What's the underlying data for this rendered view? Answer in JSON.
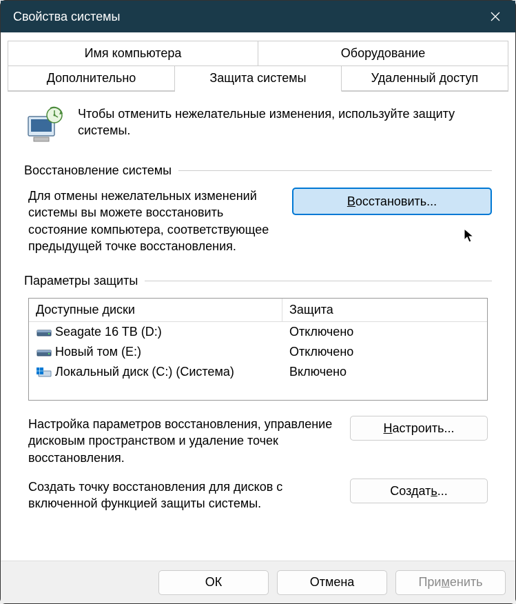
{
  "title": "Свойства системы",
  "tabs": {
    "row1": [
      "Имя компьютера",
      "Оборудование"
    ],
    "row2": [
      "Дополнительно",
      "Защита системы",
      "Удаленный доступ"
    ],
    "active": "Защита системы"
  },
  "intro": "Чтобы отменить нежелательные изменения, используйте защиту системы.",
  "restore": {
    "section_title": "Восстановление системы",
    "desc": "Для отмены нежелательных изменений системы вы можете восстановить состояние компьютера, соответствующее предыдущей точке восстановления.",
    "button": "Восстановить..."
  },
  "protection": {
    "section_title": "Параметры защиты",
    "col_disk": "Доступные диски",
    "col_protect": "Защита",
    "drives": [
      {
        "name": "Seagate 16 TB (D:)",
        "status": "Отключено",
        "type": "hdd"
      },
      {
        "name": "Новый том (E:)",
        "status": "Отключено",
        "type": "hdd"
      },
      {
        "name": "Локальный диск (C:) (Система)",
        "status": "Включено",
        "type": "system"
      }
    ]
  },
  "configure": {
    "desc": "Настройка параметров восстановления, управление дисковым пространством и удаление точек восстановления.",
    "button": "Настроить..."
  },
  "create": {
    "desc": "Создать точку восстановления для дисков с включенной функцией защиты системы.",
    "button": "Создать..."
  },
  "buttons": {
    "ok": "ОК",
    "cancel": "Отмена",
    "apply": "Применить"
  }
}
